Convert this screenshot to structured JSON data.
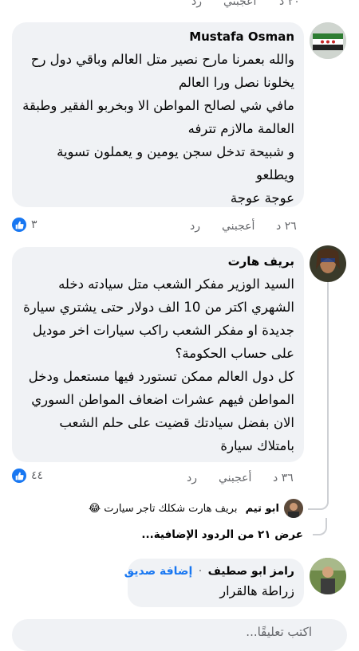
{
  "top_actions": {
    "time": "٢٠ د",
    "like": "أعجبني",
    "reply": "رد"
  },
  "comments": [
    {
      "author": "Mustafa Osman",
      "text": "والله بعمرنا مارح نصير متل العالم وباقي دول رح يخلونا نصل ورا العالم\nمافي شي لصالح المواطن الا وبخربو الفقير وطبقة العالمة مالازم تترفه\nو شبيحة تدخل سجن يومين و يعملون تسوية ويطلعو\nعوجة عوجة",
      "time": "٢٦ د",
      "like": "أعجبني",
      "reply": "رد",
      "reactions": "٣"
    },
    {
      "author": "بريف هارت",
      "text": "السيد الوزير مفكر الشعب متل سيادته دخله الشهري اكتر من 10 الف دولار حتى يشتري سيارة جديدة او مفكر الشعب راكب سيارات اخر موديل على حساب الحكومة؟\nكل دول العالم ممكن تستورد فيها مستعمل ودخل المواطن فيهم عشرات اضعاف المواطن السوري الان بفضل سيادتك قضيت على حلم الشعب بامتلاك سيارة",
      "time": "٣٦ د",
      "like": "أعجبني",
      "reply": "رد",
      "reactions": "٤٤"
    }
  ],
  "nested_reply": {
    "author": "ابو تيم",
    "text": "بريف هارت شكلك تاجر سيارت 😂"
  },
  "more_replies": "عرض ٢١ من الردود الإضافية...",
  "third_comment": {
    "author": "رامز ابو صطيف",
    "separator": "·",
    "add_friend": "إضافة صديق",
    "text": "زراطة هالقرار"
  },
  "input": {
    "placeholder": "اكتب تعليقًا..."
  },
  "colors": {
    "like_blue": "#1877f2",
    "bubble_bg": "#f0f2f5",
    "meta_gray": "#65676b",
    "thread_line": "#ced0d4"
  }
}
